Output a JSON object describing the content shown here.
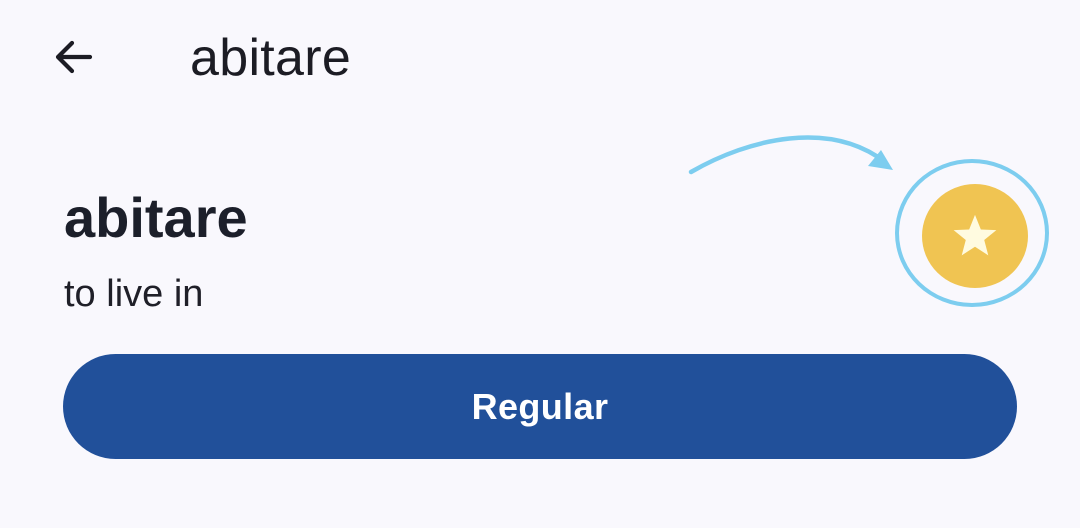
{
  "app_bar": {
    "title": "abitare",
    "back_icon": "arrow-left-icon"
  },
  "word": {
    "term": "abitare",
    "translation": "to live in"
  },
  "favorite": {
    "icon": "star-icon",
    "button_color": "#f0c452",
    "star_color": "#fffbe0",
    "highlight_color": "#7dcdef"
  },
  "actions": {
    "primary_label": "Regular",
    "primary_color": "#21509a"
  }
}
